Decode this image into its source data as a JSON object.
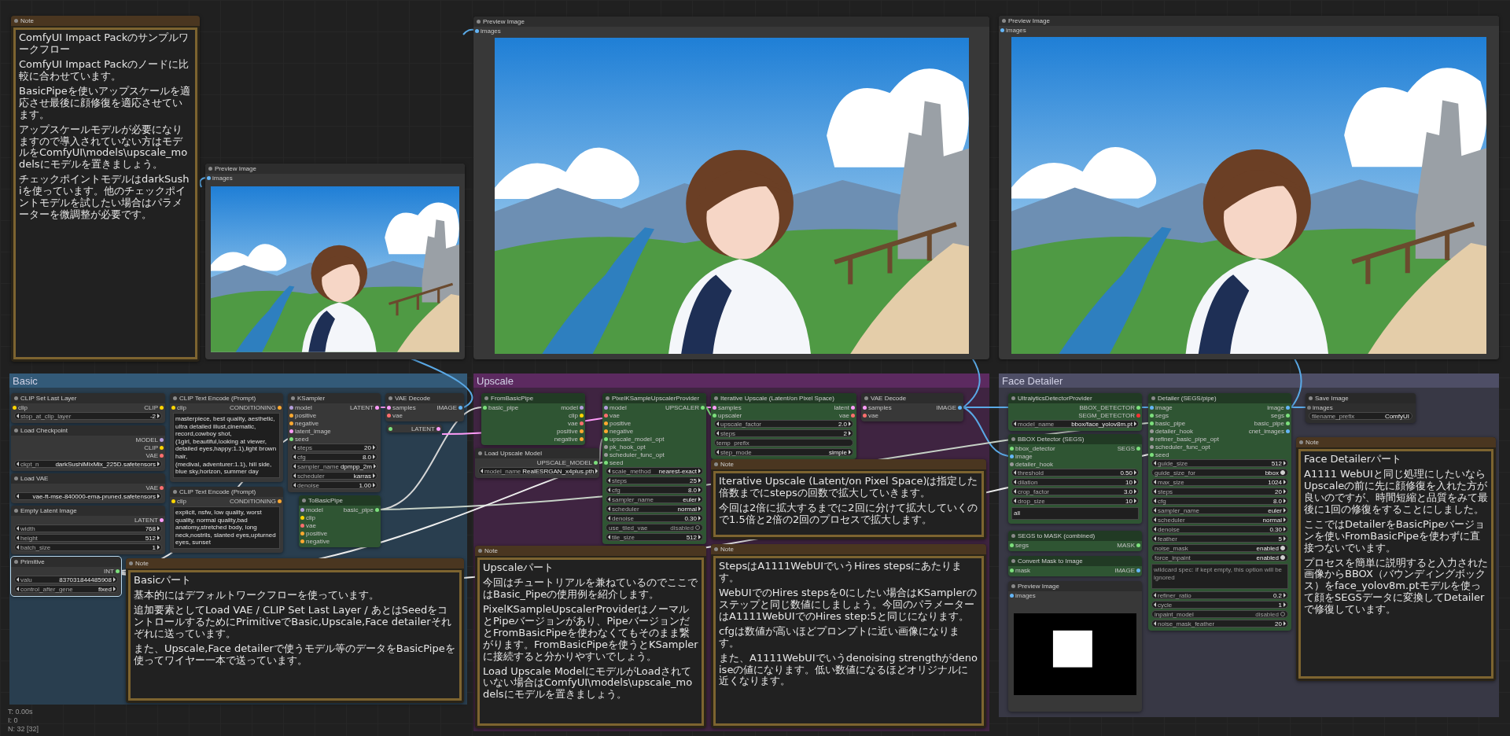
{
  "canvas_nodes": [
    {
      "title": "Note",
      "kind": "note",
      "selected": false,
      "paragraphs": [
        "ComfyUI Impact Packのサンプルワークフロー",
        "ComfyUI Impact Packのノードに比較に合わせています。",
        "BasicPipeを使いアップスケールを適応させ最後に顔修復を適応させています。",
        "アップスケールモデルが必要になりますので導入されていない方はモデルをComfyUI\\models\\upscale_modelsにモデルを置きましょう。",
        "チェックポイントモデルはdarkSushiを使っています。他のチェックポイントモデルを試したい場合はパラメーターを微調整が必要です。"
      ]
    },
    {
      "title": "Preview Image",
      "kind": "preview",
      "selected": false,
      "image": {
        "kind": "picture"
      },
      "inputs": [
        {
          "name": "images",
          "color": "#64b5f6"
        }
      ]
    },
    {
      "title": "Preview Image",
      "kind": "preview",
      "selected": false,
      "image": {
        "kind": "picture"
      },
      "inputs": [
        {
          "name": "images",
          "color": "#64b5f6"
        }
      ]
    },
    {
      "title": "Preview Image",
      "kind": "preview",
      "selected": false,
      "image": {
        "kind": "picture"
      },
      "inputs": [
        {
          "name": "images",
          "color": "#64b5f6"
        }
      ]
    }
  ],
  "groups": [
    {
      "title": "Basic",
      "color": "#335a78",
      "nodes": [
        {
          "title": "CLIP Set Last Layer",
          "kind": "node",
          "selected": false,
          "inputs": [
            {
              "name": "clip",
              "color": "#ffd500"
            }
          ],
          "outputs": [
            {
              "name": "CLIP",
              "color": "#ffd500"
            }
          ],
          "widgets": [
            {
              "kind": "number",
              "name": "stop_at_clip_layer",
              "value": "-2"
            }
          ]
        },
        {
          "title": "Load Checkpoint",
          "kind": "node",
          "selected": false,
          "outputs": [
            {
              "name": "MODEL",
              "color": "#b39ddb"
            },
            {
              "name": "CLIP",
              "color": "#ffd500"
            },
            {
              "name": "VAE",
              "color": "#ff6e6e"
            }
          ],
          "widgets": [
            {
              "kind": "combo",
              "name": "ckpt_n",
              "value": "darkSushiMixMix_225D.safetensors"
            }
          ]
        },
        {
          "title": "Load VAE",
          "kind": "node",
          "selected": false,
          "outputs": [
            {
              "name": "VAE",
              "color": "#ff6e6e"
            }
          ],
          "widgets": [
            {
              "kind": "combo",
              "value": "vae-ft-mse-840000-ema-pruned.safetensors"
            }
          ]
        },
        {
          "title": "Empty Latent Image",
          "kind": "node",
          "selected": false,
          "outputs": [
            {
              "name": "LATENT",
              "color": "#ff9cf9"
            }
          ],
          "widgets": [
            {
              "kind": "number",
              "name": "width",
              "value": "768"
            },
            {
              "kind": "number",
              "name": "height",
              "value": "512"
            },
            {
              "kind": "number",
              "name": "batch_size",
              "value": "1"
            }
          ]
        },
        {
          "title": "Primitive",
          "kind": "node",
          "selected": true,
          "outputs": [
            {
              "name": "INT",
              "color": "#7cdf7c"
            }
          ],
          "widgets": [
            {
              "kind": "number",
              "name": "valu",
              "value": "837031844485908"
            },
            {
              "kind": "combo",
              "name": "control_after_gene",
              "value": "fixed"
            }
          ]
        },
        {
          "title": "CLIP Text Encode (Prompt)",
          "kind": "node",
          "selected": false,
          "inputs": [
            {
              "name": "clip",
              "color": "#ffd500"
            }
          ],
          "outputs": [
            {
              "name": "CONDITIONING",
              "color": "#ffa931"
            }
          ],
          "widgets": [
            {
              "kind": "text",
              "value": "masterpiece, best quality, aesthetic, ultra detailed illust,cinematic, record,cowboy shot,\n(1girl, beautiful,looking at viewer, detailed eyes,happy:1.1),light brown hair,\n(medival, adventurer:1.1), hill side, blue sky,horizon, summer day"
            }
          ]
        },
        {
          "title": "CLIP Text Encode (Prompt)",
          "kind": "node",
          "selected": false,
          "inputs": [
            {
              "name": "clip",
              "color": "#ffd500"
            }
          ],
          "outputs": [
            {
              "name": "CONDITIONING",
              "color": "#ffa931"
            }
          ],
          "widgets": [
            {
              "kind": "text",
              "value": "explicit, nsfw, low quality, worst quality, normal quality,bad anatomy,stretched body, long neck,nostrils, slanted eyes,upturned eyes, sunset"
            }
          ]
        },
        {
          "title": "KSampler",
          "kind": "node",
          "selected": false,
          "inputs": [
            {
              "name": "model",
              "color": "#b39ddb"
            },
            {
              "name": "positive",
              "color": "#ffa931"
            },
            {
              "name": "negative",
              "color": "#ffa931"
            },
            {
              "name": "latent_image",
              "color": "#ff9cf9"
            },
            {
              "name": "seed",
              "color": "#7cdf7c"
            }
          ],
          "outputs": [
            {
              "name": "LATENT",
              "color": "#ff9cf9"
            }
          ],
          "widgets": [
            {
              "kind": "number",
              "name": "steps",
              "value": "20"
            },
            {
              "kind": "number",
              "name": "cfg",
              "value": "8.0"
            },
            {
              "kind": "combo",
              "name": "sampler_name",
              "value": "dpmpp_2m"
            },
            {
              "kind": "combo",
              "name": "scheduler",
              "value": "karras"
            },
            {
              "kind": "number",
              "name": "denoise",
              "value": "1.00"
            }
          ]
        },
        {
          "title": "VAE Decode",
          "kind": "node",
          "selected": false,
          "inputs": [
            {
              "name": "samples",
              "color": "#ff9cf9"
            },
            {
              "name": "vae",
              "color": "#ff6e6e"
            }
          ],
          "outputs": [
            {
              "name": "IMAGE",
              "color": "#64b5f6"
            }
          ]
        },
        {
          "kind": "reroute",
          "selected": false,
          "inputs": [
            {
              "color": "#7cdf7c"
            }
          ],
          "outputs": [
            {
              "name": "LATENT",
              "color": "#ff9cf9"
            }
          ]
        },
        {
          "title": "ToBasicPipe",
          "kind": "green",
          "selected": false,
          "inputs": [
            {
              "name": "model",
              "color": "#b39ddb"
            },
            {
              "name": "clip",
              "color": "#ffd500"
            },
            {
              "name": "vae",
              "color": "#ff6e6e"
            },
            {
              "name": "positive",
              "color": "#ffa931"
            },
            {
              "name": "negative",
              "color": "#ffa931"
            }
          ],
          "outputs": [
            {
              "name": "basic_pipe",
              "color": "#7cdf7c"
            }
          ]
        },
        {
          "title": "Note",
          "kind": "note",
          "selected": false,
          "paragraphs": [
            "Basicパート",
            "基本的にはデフォルトワークフローを使っています。",
            "追加要素としてLoad VAE / CLIP Set Last Layer / あとはSeedをコントロールするためにPrimitiveでBasic,Upscale,Face detailerそれぞれに送っています。",
            "また、Upscale,Face detailerで使うモデル等のデータをBasicPipeを使ってワイヤー一本で送っています。"
          ]
        }
      ]
    },
    {
      "title": "Upscale",
      "color": "#5c2a60",
      "nodes": [
        {
          "title": "FromBasicPipe",
          "kind": "green",
          "selected": false,
          "inputs": [
            {
              "name": "basic_pipe",
              "color": "#7cdf7c"
            }
          ],
          "outputs": [
            {
              "name": "model",
              "color": "#b39ddb"
            },
            {
              "name": "clip",
              "color": "#ffd500"
            },
            {
              "name": "vae",
              "color": "#ff6e6e"
            },
            {
              "name": "positive",
              "color": "#ffa931"
            },
            {
              "name": "negative",
              "color": "#ffa931"
            }
          ]
        },
        {
          "title": "Load Upscale Model",
          "kind": "node",
          "selected": false,
          "outputs": [
            {
              "name": "UPSCALE_MODEL",
              "color": "#7cdf7c"
            }
          ],
          "widgets": [
            {
              "kind": "combo",
              "name": "model_name",
              "value": "RealESRGAN_x4plus.pth"
            }
          ]
        },
        {
          "title": "PixelKSampleUpscalerProvider",
          "kind": "green",
          "selected": false,
          "inputs": [
            {
              "name": "model",
              "color": "#b39ddb"
            },
            {
              "name": "vae",
              "color": "#ff6e6e"
            },
            {
              "name": "positive",
              "color": "#ffa931"
            },
            {
              "name": "negative",
              "color": "#ffa931"
            },
            {
              "name": "upscale_model_opt",
              "color": "#7cdf7c"
            },
            {
              "name": "pk_hook_opt",
              "color": "#9a9a9a"
            },
            {
              "name": "scheduler_func_opt",
              "color": "#9a9a9a"
            },
            {
              "name": "seed",
              "color": "#7cdf7c"
            }
          ],
          "outputs": [
            {
              "name": "UPSCALER",
              "color": "#7cdf7c"
            }
          ],
          "widgets": [
            {
              "kind": "combo",
              "name": "scale_method",
              "value": "nearest-exact"
            },
            {
              "kind": "number",
              "name": "steps",
              "value": "25"
            },
            {
              "kind": "number",
              "name": "cfg",
              "value": "8.0"
            },
            {
              "kind": "combo",
              "name": "sampler_name",
              "value": "euler"
            },
            {
              "kind": "combo",
              "name": "scheduler",
              "value": "normal"
            },
            {
              "kind": "number",
              "name": "denoise",
              "value": "0.30"
            },
            {
              "kind": "toggle",
              "name": "use_tiled_vae",
              "value": "disabled",
              "on": false
            },
            {
              "kind": "number",
              "name": "tile_size",
              "value": "512"
            }
          ]
        },
        {
          "title": "Iterative Upscale (Latent/on Pixel Space)",
          "kind": "green",
          "selected": false,
          "inputs": [
            {
              "name": "samples",
              "color": "#ff9cf9"
            },
            {
              "name": "upscaler",
              "color": "#7cdf7c"
            }
          ],
          "outputs": [
            {
              "name": "latent",
              "color": "#ff9cf9"
            },
            {
              "name": "vae",
              "color": "#ff6e6e"
            }
          ],
          "widgets": [
            {
              "kind": "number",
              "name": "upscale_factor",
              "value": "2.0"
            },
            {
              "kind": "number",
              "name": "steps",
              "value": "2"
            },
            {
              "kind": "field",
              "placeholder": "temp_prefix"
            },
            {
              "kind": "combo",
              "name": "step_mode",
              "value": "simple"
            }
          ]
        },
        {
          "title": "Note",
          "kind": "note",
          "selected": false,
          "paragraphs": [
            "Iterative Upscale (Latent/on Pixel Space)は指定した倍数までにstepsの回数で拡大していきます。",
            "今回は2倍に拡大するまでに2回に分けて拡大していくので1.5倍と2倍の2回のプロセスで拡大します。"
          ]
        },
        {
          "title": "VAE Decode",
          "kind": "node",
          "selected": false,
          "inputs": [
            {
              "name": "samples",
              "color": "#ff9cf9"
            },
            {
              "name": "vae",
              "color": "#ff6e6e"
            }
          ],
          "outputs": [
            {
              "name": "IMAGE",
              "color": "#64b5f6"
            }
          ]
        },
        {
          "title": "Note",
          "kind": "note",
          "selected": false,
          "paragraphs": [
            "Upscaleパート",
            "今回はチュートリアルを兼ねているのでここではBasic_Pipeの使用例を紹介します。",
            "PixelKSampleUpscalerProviderはノーマルとPipeバージョンがあり、PipeバージョンだとFromBasicPipeを使わなくてもそのまま繋がります。FromBasicPipeを使うとKSamplerに接続すると分かりやすいでしょう。",
            "Load Upscale ModelにモデルがLoadされていない場合はComfyUI\\models\\upscale_modelsにモデルを置きましょう。"
          ]
        },
        {
          "title": "Note",
          "kind": "note",
          "selected": false,
          "paragraphs": [
            "StepsはA1111WebUIでいうHires stepsにあたります。",
            "WebUIでのHires stepsを0にしたい場合はKSamplerのステップと同じ数値にしましょう。今回のパラメーターはA1111WebUIでのHires step:5と同じになります。",
            "cfgは数値が高いほどプロンプトに近い画像になります。",
            "また、A1111WebUIでいうdenoising strengthがdenoiseの値になります。低い数値になるほどオリジナルに近くなります。"
          ]
        }
      ]
    },
    {
      "title": "Face Detailer",
      "color": "#4e4e66",
      "nodes": [
        {
          "title": "UltralyticsDetectorProvider",
          "kind": "green",
          "selected": false,
          "outputs": [
            {
              "name": "BBOX_DETECTOR",
              "color": "#7cdf7c"
            },
            {
              "name": "SEGM_DETECTOR",
              "color": "#ff3030"
            }
          ],
          "widgets": [
            {
              "kind": "combo",
              "name": "model_name",
              "value": "bbox/face_yolov8m.pt"
            }
          ]
        },
        {
          "title": "BBOX Detector (SEGS)",
          "kind": "green",
          "selected": false,
          "inputs": [
            {
              "name": "bbox_detector",
              "color": "#7cdf7c"
            },
            {
              "name": "image",
              "color": "#64b5f6"
            },
            {
              "name": "detailer_hook",
              "color": "#9a9a9a"
            }
          ],
          "outputs": [
            {
              "name": "SEGS",
              "color": "#7cdf7c"
            }
          ],
          "widgets": [
            {
              "kind": "number",
              "name": "threshold",
              "value": "0.50"
            },
            {
              "kind": "number",
              "name": "dilation",
              "value": "10"
            },
            {
              "kind": "number",
              "name": "crop_factor",
              "value": "3.0"
            },
            {
              "kind": "number",
              "name": "drop_size",
              "value": "10"
            },
            {
              "kind": "text",
              "value": "all"
            }
          ]
        },
        {
          "title": "SEGS to MASK (combined)",
          "kind": "green",
          "selected": false,
          "inputs": [
            {
              "name": "segs",
              "color": "#7cdf7c"
            }
          ],
          "outputs": [
            {
              "name": "MASK",
              "color": "#7cdf7c"
            }
          ]
        },
        {
          "title": "Convert Mask to Image",
          "kind": "green",
          "selected": false,
          "inputs": [
            {
              "name": "mask",
              "color": "#7cdf7c"
            }
          ],
          "outputs": [
            {
              "name": "IMAGE",
              "color": "#64b5f6"
            }
          ]
        },
        {
          "title": "Preview Image",
          "kind": "preview",
          "selected": false,
          "image": {
            "kind": "mask"
          },
          "inputs": [
            {
              "name": "images",
              "color": "#64b5f6"
            }
          ]
        },
        {
          "title": "Detailer (SEGS/pipe)",
          "kind": "green",
          "selected": false,
          "inputs": [
            {
              "name": "image",
              "color": "#64b5f6"
            },
            {
              "name": "segs",
              "color": "#7cdf7c"
            },
            {
              "name": "basic_pipe",
              "color": "#7cdf7c"
            },
            {
              "name": "detailer_hook",
              "color": "#9a9a9a"
            },
            {
              "name": "refiner_basic_pipe_opt",
              "color": "#9a9a9a"
            },
            {
              "name": "scheduler_func_opt",
              "color": "#9a9a9a"
            },
            {
              "name": "seed",
              "color": "#7cdf7c"
            }
          ],
          "outputs": [
            {
              "name": "image",
              "color": "#64b5f6"
            },
            {
              "name": "segs",
              "color": "#7cdf7c"
            },
            {
              "name": "basic_pipe",
              "color": "#7cdf7c"
            },
            {
              "name": "cnet_images",
              "color": "#64b5f6"
            }
          ],
          "widgets": [
            {
              "kind": "number",
              "name": "guide_size",
              "value": "512"
            },
            {
              "kind": "toggle",
              "name": "guide_size_for",
              "value": "bbox",
              "on": true
            },
            {
              "kind": "number",
              "name": "max_size",
              "value": "1024"
            },
            {
              "kind": "number",
              "name": "steps",
              "value": "20"
            },
            {
              "kind": "number",
              "name": "cfg",
              "value": "8.0"
            },
            {
              "kind": "combo",
              "name": "sampler_name",
              "value": "euler"
            },
            {
              "kind": "combo",
              "name": "scheduler",
              "value": "normal"
            },
            {
              "kind": "number",
              "name": "denoise",
              "value": "0.30"
            },
            {
              "kind": "number",
              "name": "feather",
              "value": "5"
            },
            {
              "kind": "toggle",
              "name": "noise_mask",
              "value": "enabled",
              "on": true
            },
            {
              "kind": "toggle",
              "name": "force_inpaint",
              "value": "enabled",
              "on": true
            },
            {
              "kind": "area",
              "placeholder": "wildcard spec: if kept empty, this option will be ignored"
            },
            {
              "kind": "number",
              "name": "refiner_ratio",
              "value": "0.2"
            },
            {
              "kind": "number",
              "name": "cycle",
              "value": "1"
            },
            {
              "kind": "toggle",
              "name": "inpaint_model",
              "value": "disabled",
              "on": false
            },
            {
              "kind": "number",
              "name": "noise_mask_feather",
              "value": "20"
            }
          ]
        },
        {
          "title": "Save Image",
          "kind": "muted",
          "selected": false,
          "inputs": [
            {
              "name": "images"
            }
          ],
          "widgets": [
            {
              "kind": "string",
              "name": "filename_prefix",
              "value": "ComfyUI"
            }
          ]
        },
        {
          "title": "Note",
          "kind": "note",
          "selected": false,
          "paragraphs": [
            "Face Detailerパート",
            "A1111 WebUIと同じ処理にしたいならUpscaleの前に先に顔修復を入れた方が良いのですが、時間短縮と品質をみて最後に1回の修復をすることにしました。",
            "ここではDetailerをBasicPipeバージョンを使いFromBasicPipeを使わずに直接つないでいます。",
            "プロセスを簡単に説明すると入力された画像からBBOX（バウンディングボックス）をface_yolov8m.ptモデルを使って顔をSEGSデータに変換してDetailerで修復しています。"
          ]
        }
      ]
    }
  ],
  "stats": [
    "T: 0.00s",
    "I: 0",
    "N: 32 [32]"
  ]
}
